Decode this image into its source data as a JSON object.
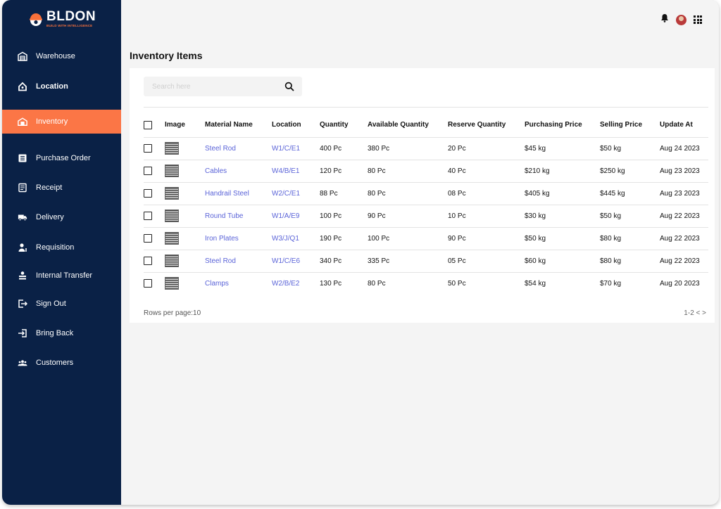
{
  "brand": {
    "name": "BLDON",
    "tagline": "BUILD WITH INTELLIGENCE"
  },
  "sidebar": {
    "items": [
      {
        "label": "Warehouse",
        "icon": "warehouse-icon"
      },
      {
        "label": "Location",
        "icon": "location-icon"
      },
      {
        "label": "Inventory",
        "icon": "inventory-icon",
        "active": true
      },
      {
        "label": "Purchase Order",
        "icon": "purchase-order-icon"
      },
      {
        "label": "Receipt",
        "icon": "receipt-icon"
      },
      {
        "label": "Delivery",
        "icon": "delivery-icon"
      },
      {
        "label": "Requisition",
        "icon": "requisition-icon"
      },
      {
        "label": "Internal Transfer",
        "icon": "internal-transfer-icon"
      },
      {
        "label": "Sign Out",
        "icon": "sign-out-icon"
      },
      {
        "label": "Bring Back",
        "icon": "bring-back-icon"
      },
      {
        "label": "Customers",
        "icon": "customers-icon"
      }
    ]
  },
  "header": {
    "icons": [
      "bell-icon",
      "avatar",
      "apps-grid-icon"
    ]
  },
  "page": {
    "title": "Inventory Items"
  },
  "search": {
    "placeholder": "Search here",
    "value": ""
  },
  "table": {
    "columns": [
      "Image",
      "Material Name",
      "Location",
      "Quantity",
      "Available Quantity",
      "Reserve Quantity",
      "Purchasing Price",
      "Selling Price",
      "Update At"
    ],
    "rows": [
      [
        "Steel Rod",
        "W1/C/E1",
        "400 Pc",
        "380 Pc",
        "20 Pc",
        "$45 kg",
        "$50 kg",
        "Aug 24 2023"
      ],
      [
        "Cables",
        "W4/B/E1",
        "120 Pc",
        "80 Pc",
        "40 Pc",
        "$210 kg",
        "$250 kg",
        "Aug 23 2023"
      ],
      [
        "Handrail Steel",
        "W2/C/E1",
        "88 Pc",
        "80 Pc",
        "08 Pc",
        "$405 kg",
        "$445 kg",
        "Aug 23 2023"
      ],
      [
        "Round Tube",
        "W1/A/E9",
        "100 Pc",
        "90 Pc",
        "10 Pc",
        "$30 kg",
        "$50 kg",
        "Aug 22 2023"
      ],
      [
        "Iron Plates",
        "W3/J/Q1",
        "190 Pc",
        "100 Pc",
        "90 Pc",
        "$50 kg",
        "$80 kg",
        "Aug 22 2023"
      ],
      [
        "Steel Rod",
        "W1/C/E6",
        "340 Pc",
        "335 Pc",
        "05 Pc",
        "$60 kg",
        "$80 kg",
        "Aug 22 2023"
      ],
      [
        "Clamps",
        "W2/B/E2",
        "130 Pc",
        "80 Pc",
        "50 Pc",
        "$54 kg",
        "$70 kg",
        "Aug 20 2023"
      ]
    ]
  },
  "pagination": {
    "rows_per_page": "Rows per page:10",
    "range": "1-2 < >"
  },
  "colors": {
    "sidebar": "#0a2146",
    "accent": "#fb7646",
    "link": "#5a63d8",
    "background": "#f4f4f4"
  }
}
